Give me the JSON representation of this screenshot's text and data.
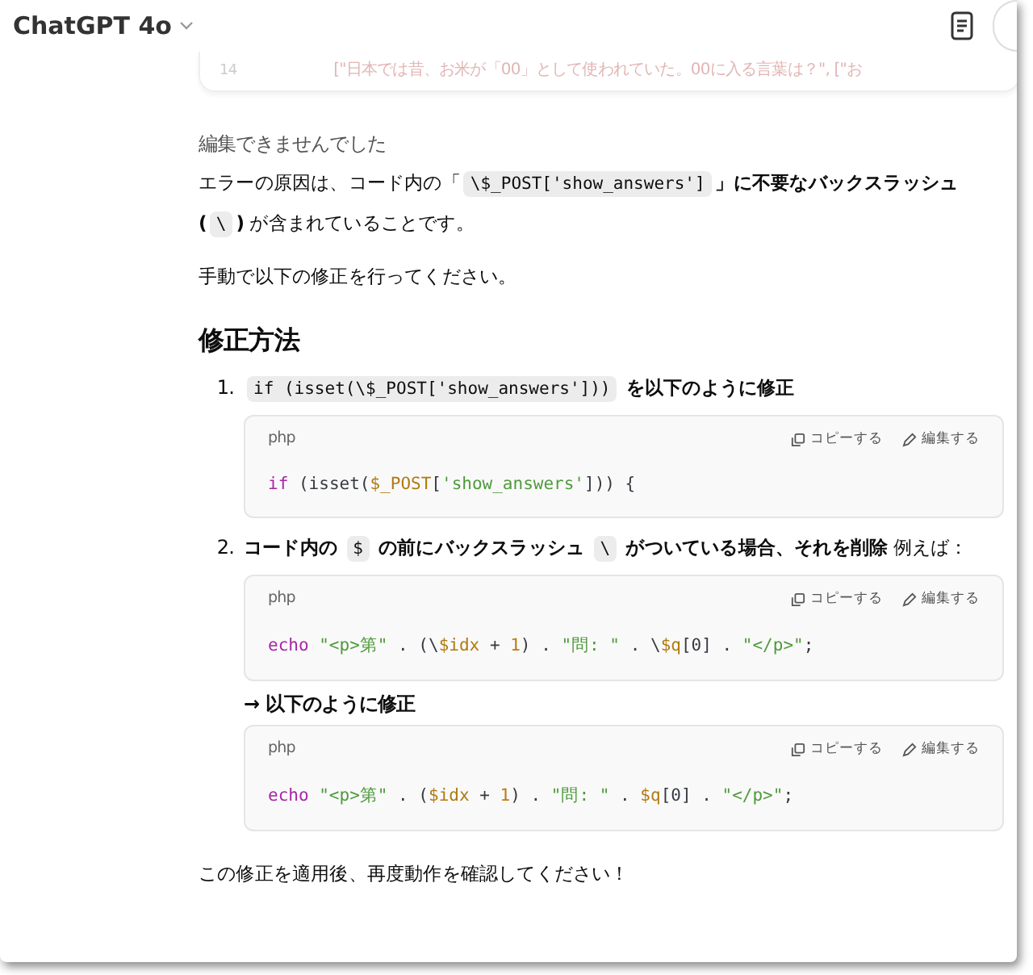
{
  "header": {
    "model_title": "ChatGPT 4o"
  },
  "faded_code": {
    "line_number": "14",
    "text": "[\"日本では昔、お米が「00」として使われていた。00に入る言葉は？\", [\"お"
  },
  "status_note": "編集できませんでした",
  "paragraphs": [
    [
      {
        "kind": "text",
        "text": "エラーの原因は、コード内の「"
      },
      {
        "kind": "code",
        "text": "\\$_POST['show_answers']"
      },
      {
        "kind": "bold",
        "text": "」に不要なバックスラッシュ ("
      },
      {
        "kind": "code",
        "text": "\\"
      },
      {
        "kind": "bold",
        "text": ") "
      },
      {
        "kind": "text",
        "text": "が含まれていることです。"
      }
    ],
    [
      {
        "kind": "text",
        "text": "手動で以下の修正を行ってください。"
      }
    ]
  ],
  "heading": "修正方法",
  "steps": [
    {
      "number": "1.",
      "segments": [
        {
          "kind": "code",
          "text": "if (isset(\\$_POST['show_answers']))"
        },
        {
          "kind": "bold",
          "text": " を以下のように修正"
        }
      ],
      "blocks": [
        {
          "kind": "code",
          "language": "php",
          "copy_label": "コピーする",
          "edit_label": "編集する",
          "tokens": [
            {
              "kind": "keyword",
              "text": "if"
            },
            {
              "kind": "plain",
              "text": " (isset("
            },
            {
              "kind": "var",
              "text": "$_POST"
            },
            {
              "kind": "plain",
              "text": "["
            },
            {
              "kind": "string",
              "text": "'show_answers'"
            },
            {
              "kind": "plain",
              "text": "])) {"
            }
          ]
        }
      ]
    },
    {
      "number": "2.",
      "segments": [
        {
          "kind": "bold",
          "text": "コード内の "
        },
        {
          "kind": "code",
          "text": "$"
        },
        {
          "kind": "bold",
          "text": " の前にバックスラッシュ "
        },
        {
          "kind": "code",
          "text": "\\"
        },
        {
          "kind": "bold",
          "text": " がついている場合、それを削除"
        },
        {
          "kind": "text",
          "text": " 例えば："
        }
      ],
      "blocks": [
        {
          "kind": "code",
          "language": "php",
          "copy_label": "コピーする",
          "edit_label": "編集する",
          "tokens": [
            {
              "kind": "keyword",
              "text": "echo "
            },
            {
              "kind": "string",
              "text": "\"<p>第\""
            },
            {
              "kind": "plain",
              "text": " . (\\"
            },
            {
              "kind": "var",
              "text": "$idx"
            },
            {
              "kind": "plain",
              "text": " + "
            },
            {
              "kind": "number",
              "text": "1"
            },
            {
              "kind": "plain",
              "text": ") . "
            },
            {
              "kind": "string",
              "text": "\"問: \""
            },
            {
              "kind": "plain",
              "text": " . \\"
            },
            {
              "kind": "var",
              "text": "$q"
            },
            {
              "kind": "plain",
              "text": "[0] . "
            },
            {
              "kind": "string",
              "text": "\"</p>\""
            },
            {
              "kind": "plain",
              "text": ";"
            }
          ]
        },
        {
          "kind": "note",
          "text": "→ 以下のように修正"
        },
        {
          "kind": "code",
          "language": "php",
          "copy_label": "コピーする",
          "edit_label": "編集する",
          "tokens": [
            {
              "kind": "keyword",
              "text": "echo "
            },
            {
              "kind": "string",
              "text": "\"<p>第\""
            },
            {
              "kind": "plain",
              "text": " . ("
            },
            {
              "kind": "var",
              "text": "$idx"
            },
            {
              "kind": "plain",
              "text": " + "
            },
            {
              "kind": "number",
              "text": "1"
            },
            {
              "kind": "plain",
              "text": ") . "
            },
            {
              "kind": "string",
              "text": "\"問: \""
            },
            {
              "kind": "plain",
              "text": " . "
            },
            {
              "kind": "var",
              "text": "$q"
            },
            {
              "kind": "plain",
              "text": "[0] . "
            },
            {
              "kind": "string",
              "text": "\"</p>\""
            },
            {
              "kind": "plain",
              "text": ";"
            }
          ]
        }
      ]
    }
  ],
  "closing": "この修正を適用後、再度動作を確認してください！"
}
